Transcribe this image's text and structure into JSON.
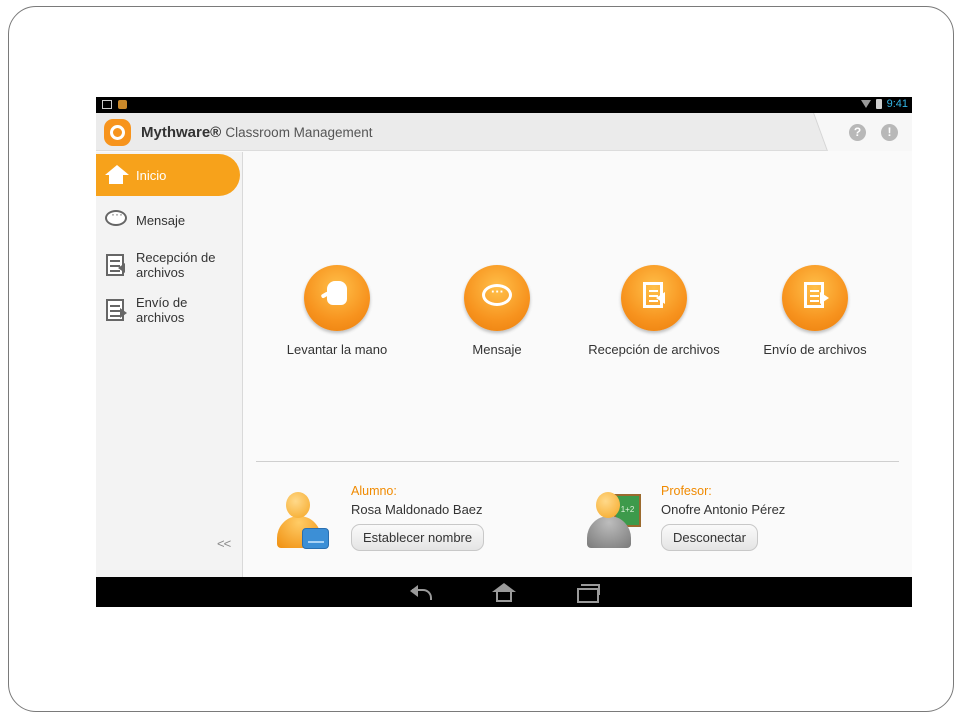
{
  "status_bar": {
    "time": "9:41"
  },
  "header": {
    "brand": "Mythware®",
    "subtitle": "Classroom Management",
    "help_icon": "?",
    "alert_icon": "!"
  },
  "sidebar": {
    "items": [
      {
        "label": "Inicio",
        "icon": "home-icon",
        "active": true
      },
      {
        "label": "Mensaje",
        "icon": "chat-icon"
      },
      {
        "label": "Recepción de archivos",
        "icon": "file-receive-icon"
      },
      {
        "label": "Envío de archivos",
        "icon": "file-send-icon"
      }
    ],
    "collapse": "<<"
  },
  "actions": [
    {
      "label": "Levantar la mano",
      "icon": "raise-hand-icon"
    },
    {
      "label": "Mensaje",
      "icon": "message-icon"
    },
    {
      "label": "Recepción de archivos",
      "icon": "file-receive-icon"
    },
    {
      "label": "Envío de archivos",
      "icon": "file-send-icon"
    }
  ],
  "student": {
    "role": "Alumno:",
    "name": "Rosa Maldonado Baez",
    "button": "Establecer nombre"
  },
  "teacher": {
    "role": "Profesor:",
    "name": "Onofre Antonio Pérez",
    "button": "Desconectar",
    "board_text": "1+2"
  },
  "colors": {
    "accent": "#f7a21b",
    "role_text": "#f08a00",
    "status_time": "#33b5e5"
  }
}
